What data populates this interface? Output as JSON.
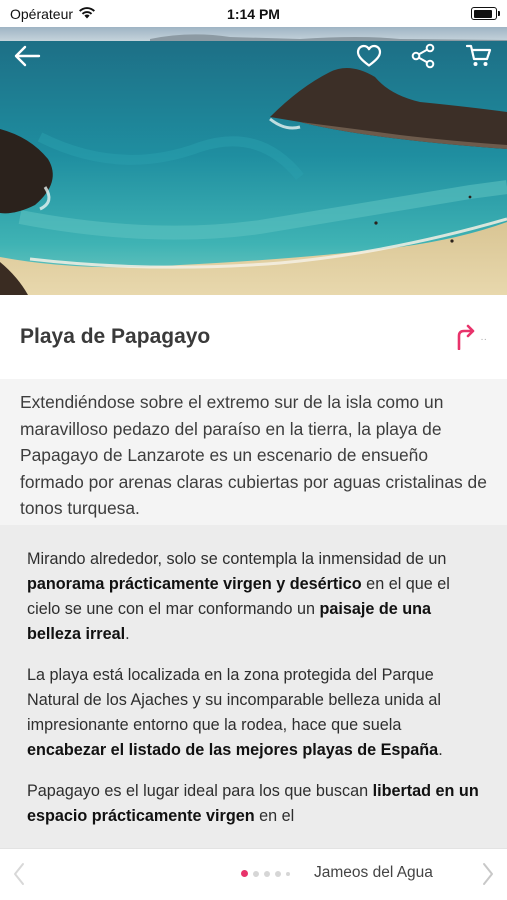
{
  "status_bar": {
    "carrier": "Opérateur",
    "time": "1:14 PM",
    "battery_level": 0.9
  },
  "hero": {
    "icons": [
      "back-arrow-icon",
      "heart-icon",
      "share-icon",
      "cart-icon"
    ]
  },
  "place": {
    "title": "Playa de Papagayo",
    "directions_icon": "directions-arrow-icon",
    "accent_color": "#e8336b"
  },
  "intro": {
    "text": "Extendiéndose sobre el extremo sur de la isla como un maravilloso pedazo del paraíso en la tierra, la playa de Papagayo de Lanzarote es un escenario de ensueño formado por arenas claras cubiertas por aguas cristalinas de tonos turquesa."
  },
  "body": {
    "p1": {
      "t1": "Mirando alrededor, solo se contempla la inmensidad de un ",
      "b1": "panorama prácticamente virgen y desértico",
      "t2": " en el que el cielo se une con el mar conformando un ",
      "b2": "paisaje de una belleza irreal",
      "t3": "."
    },
    "p2": {
      "t1": "La playa está localizada en la zona protegida del Parque Natural de los Ajaches y su incomparable belleza unida al impresionante entorno que la rodea, hace que suela ",
      "b1": "encabezar el listado de las mejores playas de España",
      "t2": "."
    },
    "p3": {
      "t1": "Papagayo es el lugar ideal para los que buscan ",
      "b1": "libertad en un espacio prácticamente virgen",
      "t2": " en el"
    }
  },
  "bottom_nav": {
    "next_label": "Jameos del Agua",
    "page_count": 5,
    "current_page": 1
  }
}
